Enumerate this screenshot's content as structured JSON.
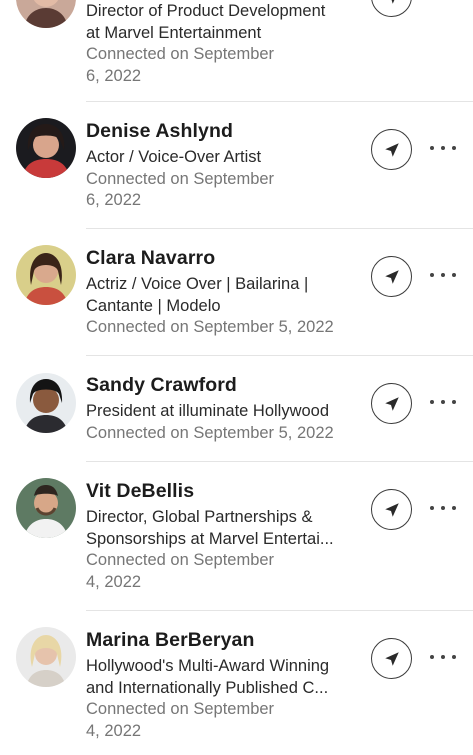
{
  "connections": [
    {
      "name": "",
      "headline_lines": [
        "Director of Product Development",
        "at Marvel Entertainment"
      ],
      "connected_lines": [
        "Connected on September",
        "6, 2022"
      ]
    },
    {
      "name": "Denise Ashlynd",
      "headline_lines": [
        "Actor / Voice-Over Artist"
      ],
      "connected_lines": [
        "Connected on September",
        "6, 2022"
      ]
    },
    {
      "name": "Clara Navarro",
      "headline_lines": [
        "Actriz / Voice Over | Bailarina |",
        "Cantante | Modelo"
      ],
      "connected_lines": [
        "Connected on September 5, 2022"
      ]
    },
    {
      "name": "Sandy Crawford",
      "headline_lines": [
        "President at illuminate Hollywood"
      ],
      "connected_lines": [
        "Connected on September 5, 2022"
      ]
    },
    {
      "name": "Vit DeBellis",
      "headline_lines": [
        "Director, Global Partnerships &",
        "Sponsorships at Marvel Entertai..."
      ],
      "connected_lines": [
        "Connected on September",
        "4, 2022"
      ]
    },
    {
      "name": "Marina BerBeryan",
      "headline_lines": [
        "Hollywood's Multi-Award Winning",
        "and Internationally Published C..."
      ],
      "connected_lines": [
        "Connected on September",
        "4, 2022"
      ]
    }
  ],
  "icons": {
    "message": "send-message-icon",
    "more": "more-options-icon"
  },
  "colors": {
    "name": "#1c1c1c",
    "secondary": "#767676",
    "divider": "#e4e4e4"
  }
}
